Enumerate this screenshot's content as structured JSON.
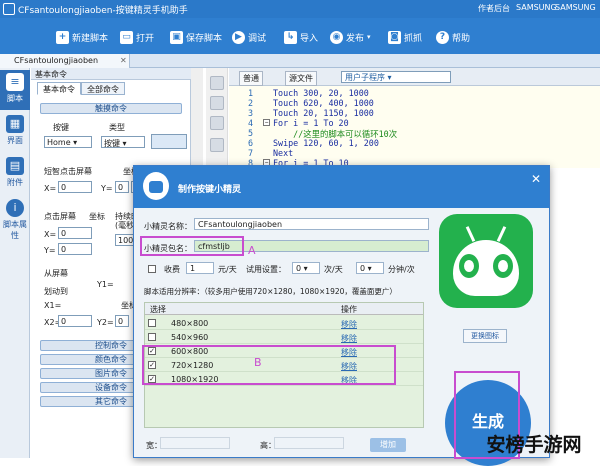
{
  "window": {
    "title": "CFsantoulongjiaoben-按键精灵手机助手",
    "right_links": [
      "作者后台",
      "SAMSUNG",
      "SAMSUNG"
    ]
  },
  "toolbar": [
    {
      "label": "新建脚本",
      "icon": "plus-icon"
    },
    {
      "label": "打开",
      "icon": "folder-icon"
    },
    {
      "label": "保存脚本",
      "icon": "save-icon"
    },
    {
      "label": "调试",
      "icon": "play-icon"
    },
    {
      "label": "导入",
      "icon": "import-icon"
    },
    {
      "label": "发布",
      "icon": "publish-icon"
    },
    {
      "label": "抓抓",
      "icon": "camera-icon"
    },
    {
      "label": "帮助",
      "icon": "help-icon"
    }
  ],
  "file_tab": "CFsantoulongjiaoben",
  "rail": [
    {
      "label": "脚本",
      "icon": "script-icon"
    },
    {
      "label": "界面",
      "icon": "ui-icon"
    },
    {
      "label": "附件",
      "icon": "attachment-icon"
    },
    {
      "label": "脚本属性",
      "icon": "info-icon"
    }
  ],
  "cmd": {
    "header": "基本命令",
    "tabs": [
      "基本命令",
      "全部命令"
    ],
    "touch_bar": "触摸命令",
    "key_label": "按键",
    "type_label": "类型",
    "key_value": "Home",
    "type_value": "按键",
    "smart_click": "短智点击屏幕",
    "coord": "坐标",
    "x_label": "X=",
    "y_label": "Y=",
    "x_val": "0",
    "y_val": "0",
    "click_screen": "点击屏幕",
    "coord2": "坐标",
    "hold": "持续时",
    "hold2": "(毫秒",
    "hold_val": "1000",
    "swipe": "从屏幕",
    "draw": "划动到",
    "x1": "X1=",
    "y1": "Y1=",
    "x2": "X2=",
    "y2": "Y2=",
    "coord3": "坐标",
    "bars": [
      "控制命令",
      "颜色命令",
      "图片命令",
      "设备命令",
      "其它命令"
    ]
  },
  "editor": {
    "btn_normal": "普通",
    "btn_source": "源文件",
    "select": "用户子程序",
    "lines": [
      {
        "n": "1",
        "t": "Touch 300, 20, 1000",
        "comment": false
      },
      {
        "n": "2",
        "t": "Touch 620, 400, 1000",
        "comment": false
      },
      {
        "n": "3",
        "t": "Touch 20, 1150, 1000",
        "comment": false
      },
      {
        "n": "4",
        "t": "For i = 1 To 20",
        "comment": false
      },
      {
        "n": "5",
        "t": "    //这里的脚本可以循环10次",
        "comment": true
      },
      {
        "n": "6",
        "t": "Swipe 120, 60, 1, 200",
        "comment": false
      },
      {
        "n": "7",
        "t": "Next",
        "comment": false
      },
      {
        "n": "8",
        "t": "For i = 1 To 10",
        "comment": false
      }
    ]
  },
  "dialog": {
    "title": "制作按键小精灵",
    "close": "✕",
    "name_label": "小精灵名称：",
    "name_val": "CFsantoulongjiaoben",
    "pkg_label": "小精灵包名：",
    "pkg_val": "cfmstljb",
    "fee_label": "收费",
    "fee_val": "1",
    "price_unit": "元/天",
    "trial_label": "试用设置：",
    "trial_val": "0",
    "trial_unit": "次/天",
    "min_val": "0",
    "min_unit": "分钟/次",
    "res_label": "脚本适用分辨率：（较多用户使用720×1280，1080×1920，覆盖面更广）",
    "col_select": "选择",
    "col_op": "操作",
    "rows": [
      {
        "res": "480×800",
        "op": "移除",
        "checked": false
      },
      {
        "res": "540×960",
        "op": "移除",
        "checked": false
      },
      {
        "res": "600×800",
        "op": "移除",
        "checked": true
      },
      {
        "res": "720×1280",
        "op": "移除",
        "checked": true
      },
      {
        "res": "1080×1920",
        "op": "移除",
        "checked": true
      }
    ],
    "change_icon": "更换图标",
    "width_label": "宽：",
    "height_label": "高：",
    "add_btn": "增加",
    "generate": "生成"
  },
  "annotations": {
    "a": "A",
    "b": "B"
  },
  "watermark": "安榜手游网",
  "colors": {
    "primary": "#2f7fd0",
    "highlight": "#c84ccf",
    "android": "#23b14d"
  }
}
